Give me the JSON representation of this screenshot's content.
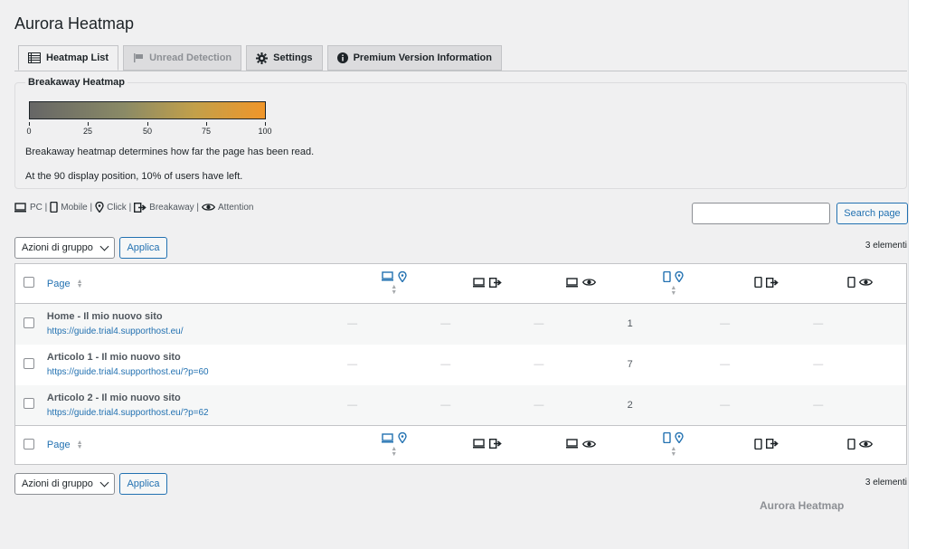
{
  "app_title": "Aurora Heatmap",
  "tabs": [
    {
      "label": "Heatmap List",
      "icon": "list-icon",
      "active": true
    },
    {
      "label": "Unread Detection",
      "icon": "flag-icon",
      "disabled": true
    },
    {
      "label": "Settings",
      "icon": "gear-icon"
    },
    {
      "label": "Premium Version Information",
      "icon": "info-icon"
    }
  ],
  "breakaway": {
    "legend": "Breakaway Heatmap",
    "scale_labels": [
      "0",
      "25",
      "50",
      "75",
      "100"
    ],
    "description_1": "Breakaway heatmap determines how far the page has been read.",
    "description_2": "At the 90 display position, 10% of users have left."
  },
  "icon_legend": {
    "pc": "PC |",
    "mobile": "Mobile |",
    "click": "Click |",
    "breakaway": "Breakaway |",
    "attention": "Attention"
  },
  "search": {
    "value": "",
    "button_label": "Search page"
  },
  "bulk": {
    "select_value": "Azioni di gruppo",
    "apply_label": "Applica"
  },
  "item_count": "3 elementi",
  "table": {
    "page_header": "Page",
    "rows": [
      {
        "title": "Home - Il mio nuovo sito",
        "url": "https://guide.trial4.supporthost.eu/",
        "pc_click": "—",
        "pc_breakaway": "—",
        "pc_attention": "—",
        "mobile_click": "1",
        "mobile_breakaway": "—",
        "mobile_attention": "—"
      },
      {
        "title": "Articolo 1 - Il mio nuovo sito",
        "url": "https://guide.trial4.supporthost.eu/?p=60",
        "pc_click": "—",
        "pc_breakaway": "—",
        "pc_attention": "—",
        "mobile_click": "7",
        "mobile_breakaway": "—",
        "mobile_attention": "—"
      },
      {
        "title": "Articolo 2 - Il mio nuovo sito",
        "url": "https://guide.trial4.supporthost.eu/?p=62",
        "pc_click": "—",
        "pc_breakaway": "—",
        "pc_attention": "—",
        "mobile_click": "2",
        "mobile_breakaway": "—",
        "mobile_attention": "—"
      }
    ]
  },
  "footer_brand": "Aurora Heatmap",
  "colors": {
    "accent": "#2271b1",
    "text": "#1d2327",
    "background": "#f0f0f1"
  }
}
